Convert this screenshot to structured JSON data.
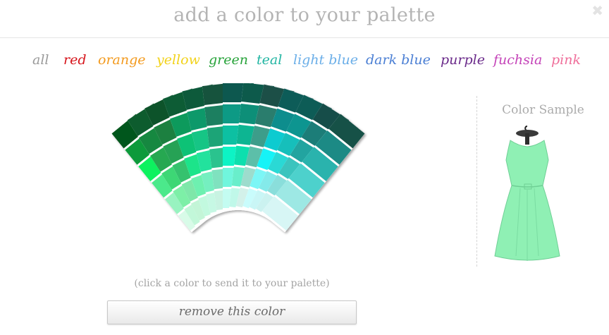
{
  "header": {
    "title": "add a color to your palette",
    "close_glyph": "✖",
    "close_icon": "close-icon"
  },
  "filters": [
    {
      "label": "all",
      "color": "#9a9a9a"
    },
    {
      "label": "red",
      "color": "#d6131a"
    },
    {
      "label": "orange",
      "color": "#f39a1e"
    },
    {
      "label": "yellow",
      "color": "#f2d21a"
    },
    {
      "label": "green",
      "color": "#27a33a"
    },
    {
      "label": "teal",
      "color": "#21b5a2"
    },
    {
      "label": "light blue",
      "color": "#6aaee8"
    },
    {
      "label": "dark blue",
      "color": "#4b7fd4"
    },
    {
      "label": "purple",
      "color": "#6a2a8a"
    },
    {
      "label": "fuchsia",
      "color": "#c443b8"
    },
    {
      "label": "pink",
      "color": "#ef6e9a"
    }
  ],
  "swatch_strips": [
    [
      "#06561d",
      "#0a9a3a",
      "#0cf25e",
      "#4be98b",
      "#98f3c0",
      "#d8fbe8"
    ],
    [
      "#0b5b2e",
      "#17883f",
      "#26a851",
      "#3ed774",
      "#7defa7",
      "#c2f7d9"
    ],
    [
      "#11522b",
      "#1b8041",
      "#27a255",
      "#35c26e",
      "#7ee7a9",
      "#c3f5d7"
    ],
    [
      "#0b5c36",
      "#0d9a5c",
      "#0fc276",
      "#1ce48a",
      "#6ef0b0",
      "#c2f9df"
    ],
    [
      "#0e5a3b",
      "#11996a",
      "#13c585",
      "#24e29d",
      "#75efc0",
      "#c6f8e4"
    ],
    [
      "#13533c",
      "#1a7f60",
      "#1fa477",
      "#2bc38e",
      "#7fe2bf",
      "#c8f3e2"
    ],
    [
      "#0b5950",
      "#0a9a85",
      "#07c0a2",
      "#0ff3c5",
      "#6ff6dd",
      "#c3fcf1"
    ],
    [
      "#0a5a4c",
      "#0c8f78",
      "#0bb592",
      "#11dfae",
      "#69eecb",
      "#c0f8e9"
    ],
    [
      "#1a4f46",
      "#2a7d6d",
      "#3c9d8a",
      "#5cbfa9",
      "#9ddccd",
      "#d3f1ea"
    ],
    [
      "#0e5b58",
      "#0b8d8d",
      "#0fcbd0",
      "#14f3f7",
      "#7cf6f6",
      "#c9fcfc"
    ],
    [
      "#105b56",
      "#119590",
      "#13bfbb",
      "#2ad9d5",
      "#84eaea",
      "#c9f6f6"
    ],
    [
      "#154e4a",
      "#1c7d78",
      "#23a4a0",
      "#3ac4be",
      "#8adedb",
      "#cbf2f0"
    ],
    [
      "#165146",
      "#1f8a85",
      "#29b3ad",
      "#4ed1cc",
      "#9de8e4",
      "#d7f6f5"
    ]
  ],
  "instructions": "(click a color to send it to your palette)",
  "remove_button": "remove this color",
  "sample": {
    "title": "Color Sample",
    "dress_color": "#8ff0b4"
  }
}
